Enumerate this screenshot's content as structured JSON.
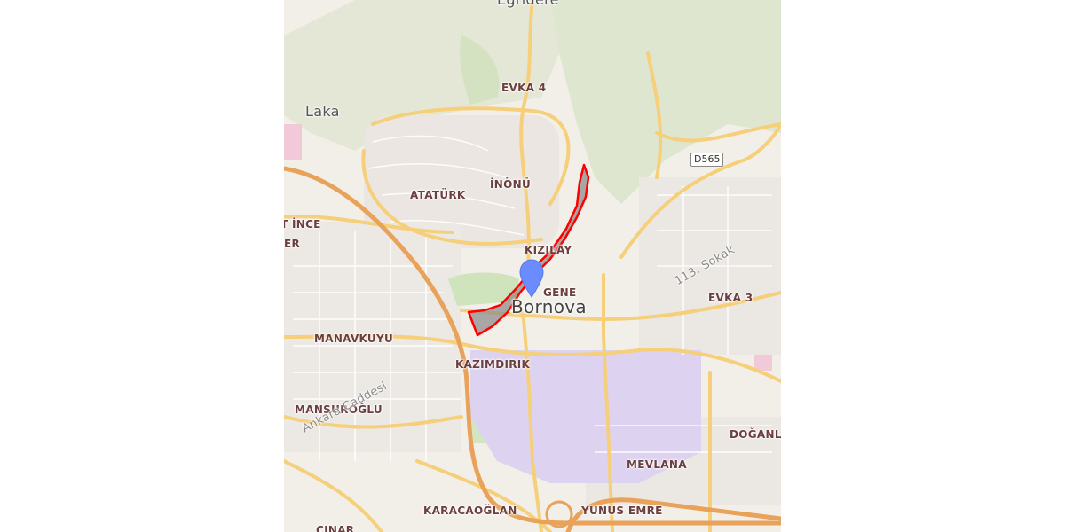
{
  "map": {
    "labels": {
      "egridere": "Eğridere",
      "evka4": "EVKA 4",
      "laka": "Laka",
      "ataturk": "ATATÜRK",
      "inonu": "İNÖNÜ",
      "kizilay": "KIZILAY",
      "ege": "GENE",
      "bornova": "Bornova",
      "ince": "T İNCE",
      "er": "ER",
      "evka3": "EVKA 3",
      "manavkuyu": "MANAVKUYU",
      "kazimdirik": "KAZIMDIRIK",
      "mansuroglu": "MANSUROĞLU",
      "doganlar": "DOĞANL",
      "mevlana": "MEVLANA",
      "karacaoglan": "KARACAOĞLAN",
      "yunusemre": "YUNUS EMRE",
      "cinar": "ÇINAR",
      "ankara_caddesi": "Ankara Caddesi",
      "sokak113": "113. Sokak",
      "d565": "D565"
    },
    "colors": {
      "land": "#f2efe9",
      "road_major": "#f6cf7a",
      "road_motorway": "#e8a25a",
      "forest": "#d8e5c8",
      "industrial": "#ddd3f0",
      "highlight_fill": "#8f8f8f",
      "highlight_stroke": "#ff0000",
      "marker": "#6b8cff"
    },
    "marker_icon": "map-pin-icon"
  }
}
